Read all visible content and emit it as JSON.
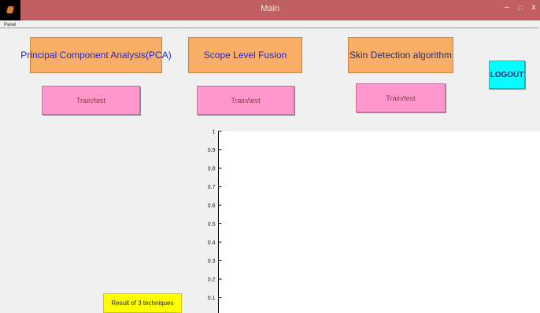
{
  "window": {
    "title": "Main",
    "minimize_glyph": "–",
    "maximize_glyph": "□",
    "close_glyph": "x"
  },
  "panel": {
    "label": "Panel"
  },
  "techniques": [
    {
      "label": "Principal Component Analysis(PCA)",
      "button": "Train/test"
    },
    {
      "label": "Scope Level Fusion",
      "button": "Train/test"
    },
    {
      "label": "Skin Detection algorithm",
      "button": "Train/test"
    }
  ],
  "logout": {
    "label": "LOGOUT"
  },
  "result": {
    "label": "Result of 3 techniques"
  },
  "chart_data": {
    "type": "line",
    "y_ticks": [
      1,
      0.9,
      0.8,
      0.7,
      0.6,
      0.5,
      0.4,
      0.3,
      0.2,
      0.1
    ],
    "y_tick_labels": [
      "1",
      "0.9",
      "0.8",
      "0.7",
      "0.6",
      "0.5",
      "0.4",
      "0.3",
      "0.2",
      "0.1"
    ],
    "ylim": [
      0,
      1
    ],
    "series": [],
    "grid": false
  },
  "colors": {
    "titlebar": "#c06062",
    "technique_box": "#f9ae67",
    "train_button": "#ff97cc",
    "logout_button": "#00ffff",
    "result_button": "#ffff00"
  }
}
